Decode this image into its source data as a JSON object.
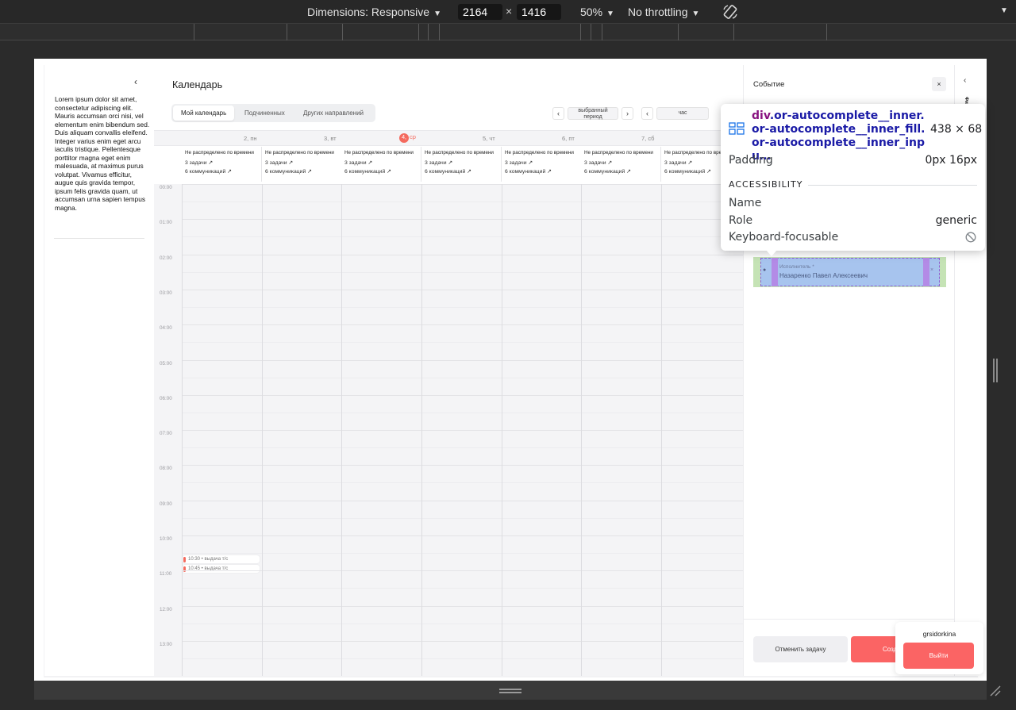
{
  "devtools": {
    "dimensions_label": "Dimensions: Responsive",
    "width": "2164",
    "x_sep": "×",
    "height": "1416",
    "zoom": "50%",
    "throttling": "No throttling"
  },
  "sidebar": {
    "collapse_glyph": "‹",
    "text": "Lorem ipsum dolor sit amet, consectetur adipiscing elit. Mauris accumsan orci nisi, vel elementum enim bibendum sed. Duis aliquam convallis eleifend. Integer varius enim eget arcu iaculis tristique. Pellentesque porttitor magna eget enim malesuada, at maximus purus volutpat. Vivamus efficitur, augue quis gravida tempor, ipsum felis gravida quam, ut accumsan urna sapien tempus magna."
  },
  "calendar": {
    "title": "Календарь",
    "tabs": [
      {
        "label": "Мой календарь",
        "active": true
      },
      {
        "label": "Подчиненных",
        "active": false
      },
      {
        "label": "Других направлений",
        "active": false
      }
    ],
    "period_label": "выбранный период",
    "scale_label": "час",
    "nav_prev": "‹",
    "nav_next": "›",
    "days": [
      {
        "num": "2,",
        "wd": "пн",
        "today": false
      },
      {
        "num": "3,",
        "wd": "вт",
        "today": false
      },
      {
        "num": "4,",
        "wd": "ср",
        "today": true
      },
      {
        "num": "5,",
        "wd": "чт",
        "today": false
      },
      {
        "num": "6,",
        "wd": "пт",
        "today": false
      },
      {
        "num": "7,",
        "wd": "сб",
        "today": false
      }
    ],
    "unscheduled": {
      "title": "Не распределено по времени",
      "tasks": "3 задачи",
      "comms": "6 коммуникаций",
      "link_glyph": "↗"
    },
    "hours": [
      "00:00",
      "01:00",
      "02:00",
      "03:00",
      "04:00",
      "05:00",
      "06:00",
      "07:00",
      "08:00",
      "09:00",
      "10:00",
      "11:00",
      "12:00",
      "13:00"
    ],
    "events": [
      {
        "label": "10:30 • выдача т/с"
      },
      {
        "label": "10:45 • выдача т/с"
      }
    ]
  },
  "event_panel": {
    "title": "Событие",
    "close_glyph": "×",
    "field_label": "Исполнитель *",
    "field_value": "Назаренко Павел Алексеевич",
    "field_clear": "×",
    "field_icon": "user-icon",
    "cancel_label": "Отменить задачу",
    "create_label": "Создать"
  },
  "filters": {
    "label": "Фильтры",
    "chevron": "‹"
  },
  "user": {
    "name": "grsidorkina",
    "logout_label": "Выйти"
  },
  "inspector": {
    "tag": "div",
    "selector": ".or-autocomplete__inner.or-autocomplete__inner_fill.or-autocomplete__inner_inpu…",
    "size": "438 × 68",
    "padding_label": "Padding",
    "padding_value": "0px 16px",
    "section": "ACCESSIBILITY",
    "name_label": "Name",
    "role_label": "Role",
    "role_value": "generic",
    "focus_label": "Keyboard-focusable"
  },
  "colors": {
    "accent_red": "#fb6464",
    "today_red": "#f46a5e",
    "inspector_blue": "#1a1aa6",
    "inspector_tag": "#881280"
  }
}
